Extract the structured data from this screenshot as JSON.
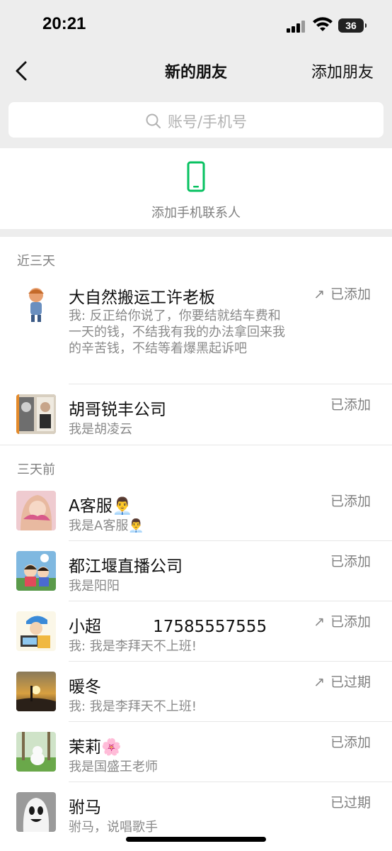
{
  "status_bar": {
    "time": "20:21",
    "battery": "36"
  },
  "nav": {
    "title": "新的朋友",
    "add_friend": "添加朋友"
  },
  "search": {
    "placeholder": "账号/手机号"
  },
  "phone_contacts": {
    "label": "添加手机联系人"
  },
  "sections": [
    {
      "header": "近三天"
    },
    {
      "header": "三天前"
    }
  ],
  "friends": [
    {
      "name": "大自然搬运工许老板",
      "message": "我: 反正给你说了，你要结就结车费和一天的钱，不结我有我的办法拿回来我的辛苦钱，不结等着爆黑起诉吧",
      "status": "已添加",
      "arrow": true
    },
    {
      "name": "胡哥锐丰公司",
      "message": "我是胡凌云",
      "status": "已添加",
      "arrow": false
    },
    {
      "name": "A客服👨‍💼",
      "message": "我是A客服👨‍💼",
      "status": "已添加",
      "arrow": false
    },
    {
      "name": "都江堰直播公司",
      "message": "我是阳阳",
      "status": "已添加",
      "arrow": false
    },
    {
      "name": "小超          17585557555",
      "message": "我: 我是李拜天不上班!",
      "status": "已添加",
      "arrow": true
    },
    {
      "name": "暖冬",
      "message": "我: 我是李拜天不上班!",
      "status": "已过期",
      "arrow": true
    },
    {
      "name": "茉莉🌸",
      "message": "我是国盛王老师",
      "status": "已添加",
      "arrow": false
    },
    {
      "name": "驸马",
      "message": "驸马，说唱歌手",
      "status": "已过期",
      "arrow": false
    }
  ],
  "colors": {
    "accent_green": "#07c160",
    "background": "#ededed"
  }
}
